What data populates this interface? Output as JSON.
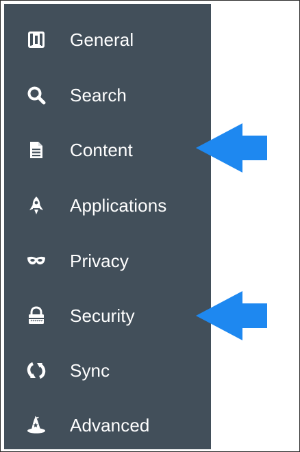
{
  "sidebar": {
    "items": [
      {
        "label": "General",
        "icon": "general-icon"
      },
      {
        "label": "Search",
        "icon": "search-icon"
      },
      {
        "label": "Content",
        "icon": "document-icon"
      },
      {
        "label": "Applications",
        "icon": "rocket-icon"
      },
      {
        "label": "Privacy",
        "icon": "mask-icon"
      },
      {
        "label": "Security",
        "icon": "lock-icon"
      },
      {
        "label": "Sync",
        "icon": "sync-icon"
      },
      {
        "label": "Advanced",
        "icon": "wizard-hat-icon"
      }
    ]
  },
  "annotations": {
    "arrow_color": "#1e88f0",
    "pointing_to": [
      "Content",
      "Security"
    ]
  },
  "colors": {
    "sidebar_bg": "#424f5a",
    "label": "#ffffff"
  }
}
